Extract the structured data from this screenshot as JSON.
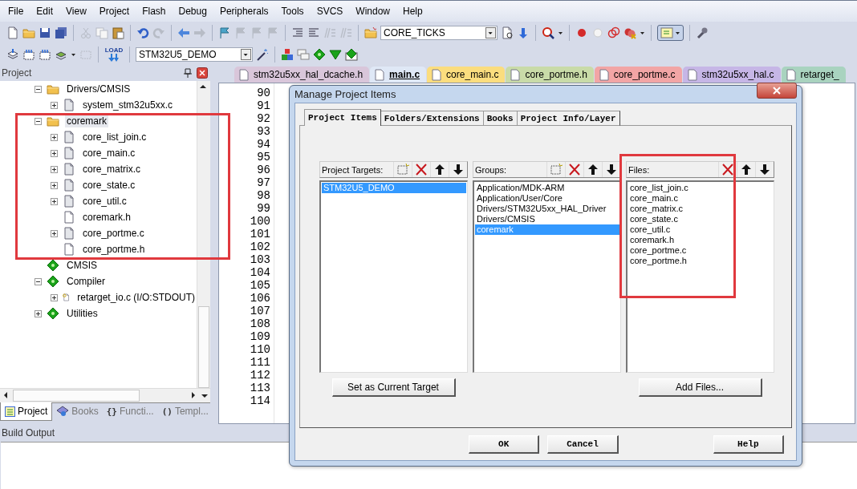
{
  "menu": [
    "File",
    "Edit",
    "View",
    "Project",
    "Flash",
    "Debug",
    "Peripherals",
    "Tools",
    "SVCS",
    "Window",
    "Help"
  ],
  "toolbar": {
    "find_field": "CORE_TICKS",
    "load_label": "LOAD",
    "target_field": "STM32U5_DEMO"
  },
  "project_panel": {
    "title": "Project",
    "tree": [
      {
        "label": "Drivers/CMSIS",
        "kind": "folder",
        "expanded": true,
        "children": [
          {
            "label": "system_stm32u5xx.c",
            "kind": "file",
            "expanded": false
          }
        ]
      },
      {
        "label": "coremark",
        "kind": "folder",
        "expanded": true,
        "selected": true,
        "children": [
          {
            "label": "core_list_join.c",
            "kind": "file",
            "expanded": false
          },
          {
            "label": "core_main.c",
            "kind": "file",
            "expanded": false
          },
          {
            "label": "core_matrix.c",
            "kind": "file",
            "expanded": false
          },
          {
            "label": "core_state.c",
            "kind": "file",
            "expanded": false
          },
          {
            "label": "core_util.c",
            "kind": "file",
            "expanded": false
          },
          {
            "label": "coremark.h",
            "kind": "header"
          },
          {
            "label": "core_portme.c",
            "kind": "file",
            "expanded": false
          },
          {
            "label": "core_portme.h",
            "kind": "header"
          }
        ]
      },
      {
        "label": "CMSIS",
        "kind": "component"
      },
      {
        "label": "Compiler",
        "kind": "component",
        "expanded": true,
        "children": [
          {
            "label": "retarget_io.c (I/O:STDOUT)",
            "kind": "config",
            "expanded": false
          }
        ]
      },
      {
        "label": "Utilities",
        "kind": "component",
        "expanded": false
      }
    ],
    "tabs": [
      {
        "kind": "project",
        "label": "Project",
        "selected": true
      },
      {
        "kind": "books",
        "label": "Books",
        "selected": false
      },
      {
        "kind": "glyph",
        "glyph": "{}",
        "label": "Functi...",
        "selected": false
      },
      {
        "kind": "glyph",
        "glyph": "()",
        "label": "Templ...",
        "selected": false
      }
    ]
  },
  "editor": {
    "tabs": [
      {
        "label": "stm32u5xx_hal_dcache.h",
        "color": "#d9c6da",
        "selected": false
      },
      {
        "label": "main.c",
        "color": "#dfe8f6",
        "selected": true
      },
      {
        "label": "core_main.c",
        "color": "#fbdd7e",
        "selected": false
      },
      {
        "label": "core_portme.h",
        "color": "#c9dba8",
        "selected": false
      },
      {
        "label": "core_portme.c",
        "color": "#f2a5a5",
        "selected": false
      },
      {
        "label": "stm32u5xx_hal.c",
        "color": "#c6b6e6",
        "selected": false
      },
      {
        "label": "retarget_",
        "color": "#a9d3bf",
        "selected": false
      }
    ],
    "line_numbers": [
      "90",
      "91",
      "92",
      "93",
      "94",
      "95",
      "96",
      "97",
      "98",
      "99",
      "100",
      "101",
      "102",
      "103",
      "104",
      "105",
      "106",
      "107",
      "108",
      "109",
      "110",
      "111",
      "112",
      "113",
      "114"
    ]
  },
  "build_output": {
    "title": "Build Output"
  },
  "dialog": {
    "title": "Manage Project Items",
    "tabs": [
      {
        "label": "Project Items",
        "selected": true
      },
      {
        "label": "Folders/Extensions",
        "selected": false
      },
      {
        "label": "Books",
        "selected": false
      },
      {
        "label": "Project Info/Layer",
        "selected": false
      }
    ],
    "lists": [
      {
        "title": "Project Targets:",
        "new_button": true,
        "items": [
          {
            "label": "STM32U5_DEMO",
            "selected": true
          }
        ],
        "button": "Set as Current Target"
      },
      {
        "title": "Groups:",
        "new_button": true,
        "items": [
          {
            "label": "Application/MDK-ARM",
            "selected": false
          },
          {
            "label": "Application/User/Core",
            "selected": false
          },
          {
            "label": "Drivers/STM32U5xx_HAL_Driver",
            "selected": false
          },
          {
            "label": "Drivers/CMSIS",
            "selected": false
          },
          {
            "label": "coremark",
            "selected": true
          }
        ]
      },
      {
        "title": "Files:",
        "new_button": false,
        "items": [
          {
            "label": "core_list_join.c",
            "selected": false
          },
          {
            "label": "core_main.c",
            "selected": false
          },
          {
            "label": "core_matrix.c",
            "selected": false
          },
          {
            "label": "core_state.c",
            "selected": false
          },
          {
            "label": "core_util.c",
            "selected": false
          },
          {
            "label": "coremark.h",
            "selected": false
          },
          {
            "label": "core_portme.c",
            "selected": false
          },
          {
            "label": "core_portme.h",
            "selected": false
          }
        ],
        "button": "Add Files..."
      }
    ],
    "footer": [
      "OK",
      "Cancel",
      "Help"
    ]
  }
}
